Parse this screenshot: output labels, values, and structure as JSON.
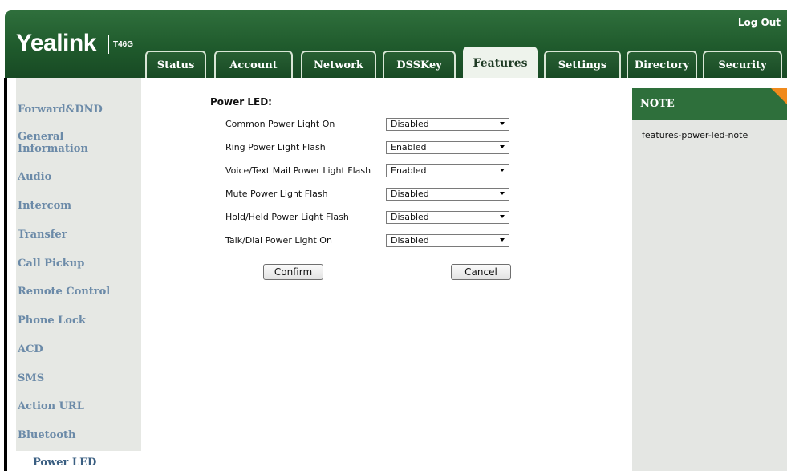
{
  "header": {
    "brand": "Yealink",
    "model": "T46G",
    "logout_label": "Log Out"
  },
  "tabs": [
    {
      "label": "Status"
    },
    {
      "label": "Account"
    },
    {
      "label": "Network"
    },
    {
      "label": "DSSKey"
    },
    {
      "label": "Features",
      "active": true
    },
    {
      "label": "Settings"
    },
    {
      "label": "Directory"
    },
    {
      "label": "Security"
    }
  ],
  "sidebar": {
    "items": [
      {
        "label": "Forward&DND"
      },
      {
        "label": "General Information"
      },
      {
        "label": "Audio"
      },
      {
        "label": "Intercom"
      },
      {
        "label": "Transfer"
      },
      {
        "label": "Call Pickup"
      },
      {
        "label": "Remote Control"
      },
      {
        "label": "Phone Lock"
      },
      {
        "label": "ACD"
      },
      {
        "label": "SMS"
      },
      {
        "label": "Action URL"
      },
      {
        "label": "Bluetooth"
      },
      {
        "label": "Power LED",
        "active": true
      }
    ]
  },
  "form": {
    "section_title": "Power LED:",
    "rows": [
      {
        "label": "Common Power Light On",
        "value": "Disabled"
      },
      {
        "label": "Ring Power Light Flash",
        "value": "Enabled"
      },
      {
        "label": "Voice/Text Mail Power Light Flash",
        "value": "Enabled"
      },
      {
        "label": "Mute Power Light Flash",
        "value": "Disabled"
      },
      {
        "label": "Hold/Held Power Light Flash",
        "value": "Disabled"
      },
      {
        "label": "Talk/Dial Power Light On",
        "value": "Disabled"
      }
    ],
    "confirm_label": "Confirm",
    "cancel_label": "Cancel"
  },
  "note": {
    "title": "NOTE",
    "text": "features-power-led-note"
  },
  "colors": {
    "header_green": "#1f5a2c",
    "note_header_green": "#2e6f3b",
    "note_corner_orange": "#f08a1c",
    "sidebar_link": "#6b8aa8"
  }
}
